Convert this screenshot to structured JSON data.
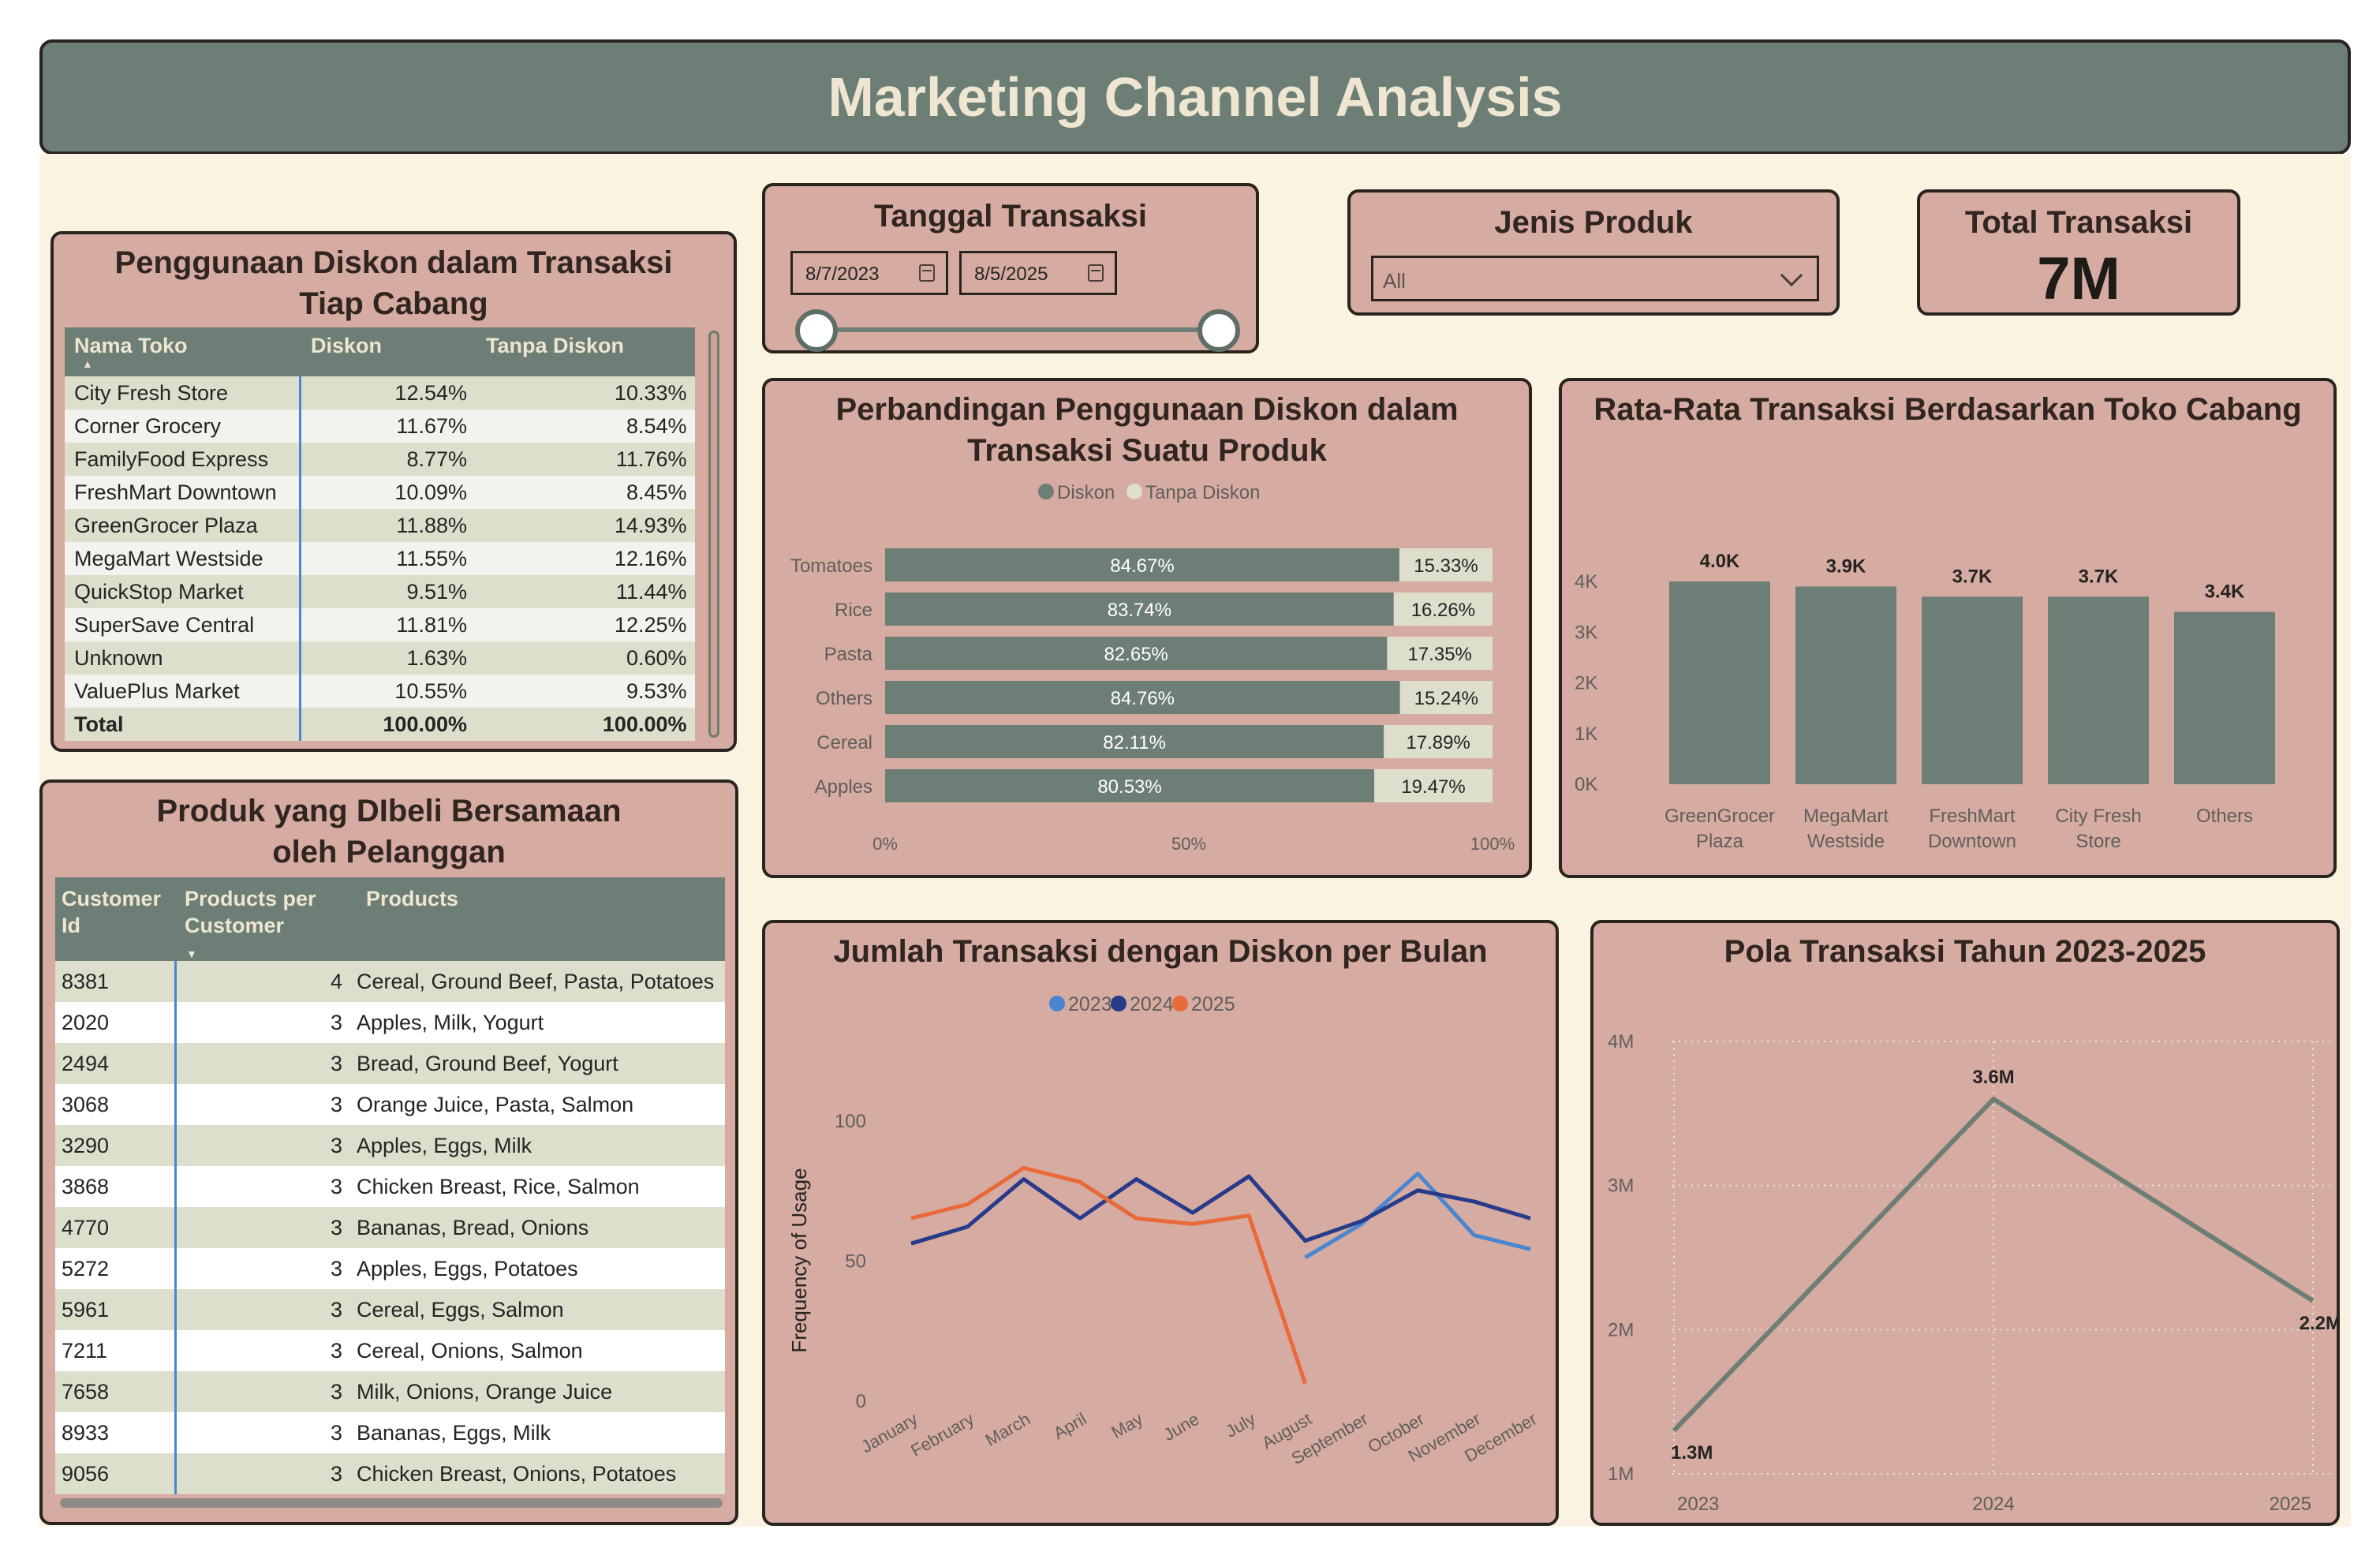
{
  "header": {
    "title": "Marketing Channel Analysis"
  },
  "date_filter": {
    "title": "Tanggal Transaksi",
    "start": "8/7/2023",
    "end": "8/5/2025"
  },
  "product_filter": {
    "title": "Jenis Produk",
    "selected": "All"
  },
  "kpi": {
    "title": "Total Transaksi",
    "value": "7M"
  },
  "discount_table": {
    "title": "Penggunaan Diskon dalam Transaksi Tiap Cabang",
    "columns": [
      "Nama Toko",
      "Diskon",
      "Tanpa Diskon"
    ],
    "rows": [
      [
        "City Fresh Store",
        "12.54%",
        "10.33%"
      ],
      [
        "Corner Grocery",
        "11.67%",
        "8.54%"
      ],
      [
        "FamilyFood Express",
        "8.77%",
        "11.76%"
      ],
      [
        "FreshMart Downtown",
        "10.09%",
        "8.45%"
      ],
      [
        "GreenGrocer Plaza",
        "11.88%",
        "14.93%"
      ],
      [
        "MegaMart Westside",
        "11.55%",
        "12.16%"
      ],
      [
        "QuickStop Market",
        "9.51%",
        "11.44%"
      ],
      [
        "SuperSave Central",
        "11.81%",
        "12.25%"
      ],
      [
        "Unknown",
        "1.63%",
        "0.60%"
      ],
      [
        "ValuePlus Market",
        "10.55%",
        "9.53%"
      ]
    ],
    "total": [
      "Total",
      "100.00%",
      "100.00%"
    ]
  },
  "basket_table": {
    "title": "Produk yang DIbeli Bersamaan oleh Pelanggan",
    "columns": [
      "Customer Id",
      "Products per Customer",
      "Products"
    ],
    "rows": [
      [
        "8381",
        "4",
        "Cereal, Ground Beef, Pasta, Potatoes"
      ],
      [
        "2020",
        "3",
        "Apples, Milk, Yogurt"
      ],
      [
        "2494",
        "3",
        "Bread, Ground Beef, Yogurt"
      ],
      [
        "3068",
        "3",
        "Orange Juice, Pasta, Salmon"
      ],
      [
        "3290",
        "3",
        "Apples, Eggs, Milk"
      ],
      [
        "3868",
        "3",
        "Chicken Breast, Rice, Salmon"
      ],
      [
        "4770",
        "3",
        "Bananas, Bread, Onions"
      ],
      [
        "5272",
        "3",
        "Apples, Eggs, Potatoes"
      ],
      [
        "5961",
        "3",
        "Cereal, Eggs, Salmon"
      ],
      [
        "7211",
        "3",
        "Cereal, Onions, Salmon"
      ],
      [
        "7658",
        "3",
        "Milk, Onions, Orange Juice"
      ],
      [
        "8933",
        "3",
        "Bananas, Eggs, Milk"
      ],
      [
        "9056",
        "3",
        "Chicken Breast, Onions, Potatoes"
      ]
    ]
  },
  "chart_data": [
    {
      "type": "bar",
      "orientation": "horizontal",
      "stacked": "100%",
      "title": "Perbandingan Penggunaan Diskon dalam Transaksi Suatu Produk",
      "categories": [
        "Tomatoes",
        "Rice",
        "Pasta",
        "Others",
        "Cereal",
        "Apples"
      ],
      "series": [
        {
          "name": "Diskon",
          "color": "#6c7e75",
          "values": [
            84.67,
            83.74,
            82.65,
            84.76,
            82.11,
            80.53
          ],
          "labels": [
            "84.67%",
            "83.74%",
            "82.65%",
            "84.76%",
            "82.11%",
            "80.53%"
          ]
        },
        {
          "name": "Tanpa Diskon",
          "color": "#dddfcc",
          "values": [
            15.33,
            16.26,
            17.35,
            15.24,
            17.89,
            19.47
          ],
          "labels": [
            "15.33%",
            "16.26%",
            "17.35%",
            "15.24%",
            "17.89%",
            "19.47%"
          ]
        }
      ],
      "x_ticks": [
        "0%",
        "50%",
        "100%"
      ],
      "legend": "top-center"
    },
    {
      "type": "bar",
      "title": "Rata-Rata Transaksi Berdasarkan Toko Cabang",
      "categories": [
        "GreenGrocer Plaza",
        "MegaMart Westside",
        "FreshMart Downtown",
        "City Fresh Store",
        "Others"
      ],
      "values": [
        4.0,
        3.9,
        3.7,
        3.7,
        3.4
      ],
      "data_labels": [
        "4.0K",
        "3.9K",
        "3.7K",
        "3.7K",
        "3.4K"
      ],
      "y_ticks": [
        "0K",
        "1K",
        "2K",
        "3K",
        "4K"
      ],
      "ylim": [
        0,
        4
      ],
      "color": "#6c7e75"
    },
    {
      "type": "line",
      "title": "Jumlah Transaksi dengan Diskon per Bulan",
      "ylabel": "Frequency of Usage",
      "categories": [
        "January",
        "February",
        "March",
        "April",
        "May",
        "June",
        "July",
        "August",
        "September",
        "October",
        "November",
        "December"
      ],
      "series": [
        {
          "name": "2023",
          "color": "#4a86cf",
          "values": [
            null,
            null,
            null,
            null,
            null,
            null,
            null,
            51,
            63,
            81,
            59,
            54
          ]
        },
        {
          "name": "2024",
          "color": "#283a8a",
          "values": [
            56,
            62,
            79,
            65,
            79,
            67,
            80,
            57,
            64,
            75,
            71,
            65
          ]
        },
        {
          "name": "2025",
          "color": "#e8693a",
          "values": [
            65,
            70,
            83,
            78,
            65,
            63,
            66,
            6,
            null,
            null,
            null,
            null
          ]
        }
      ],
      "y_ticks": [
        "0",
        "50",
        "100"
      ],
      "ylim": [
        0,
        100
      ],
      "legend": "top-center"
    },
    {
      "type": "line",
      "title": "Pola Transaksi Tahun 2023-2025",
      "x": [
        "2023",
        "2024",
        "2025"
      ],
      "values": [
        1.3,
        3.6,
        2.2
      ],
      "data_labels": [
        "1.3M",
        "3.6M",
        "2.2M"
      ],
      "y_ticks": [
        "1M",
        "2M",
        "3M",
        "4M"
      ],
      "ylim": [
        1,
        4
      ],
      "grid": true,
      "color": "#6c7e75"
    }
  ]
}
